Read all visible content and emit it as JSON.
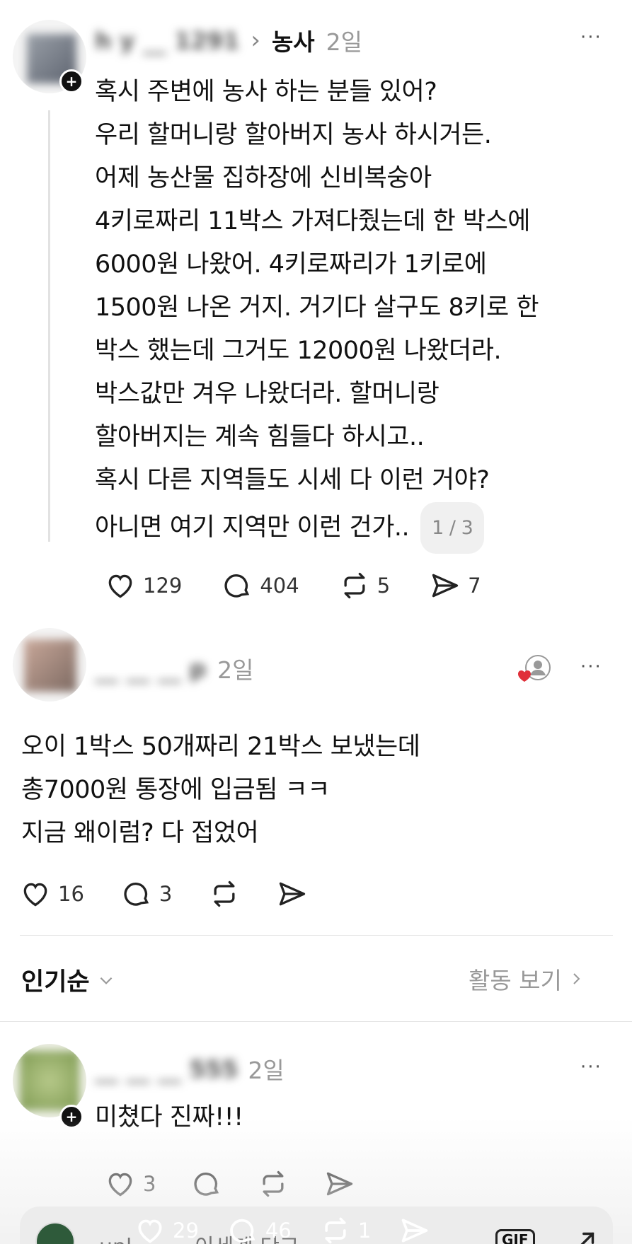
{
  "post": {
    "username": "h y __ 1291",
    "arrow": "›",
    "topic": "농사",
    "time": "2일",
    "more": "···",
    "lines": [
      "혹시 주변에 농사 하는 분들 있어?",
      "우리 할머니랑 할아버지 농사 하시거든.",
      "어제 농산물 집하장에 신비복숭아",
      "4키로짜리 11박스 가져다줬는데 한 박스에",
      "6000원 나왔어. 4키로짜리가 1키로에",
      "1500원 나온 거지. 거기다 살구도 8키로 한",
      "박스 했는데 그거도 12000원 나왔더라.",
      "박스값만 겨우 나왔더라. 할머니랑",
      "할아버지는 계속 힘들다 하시고..",
      "혹시 다른 지역들도 시세 다 이런 거야?",
      "아니면 여기 지역만 이런 건가.."
    ],
    "page_badge": "1 / 3",
    "likes": "129",
    "comments": "404",
    "reposts": "5",
    "shares": "7"
  },
  "reply": {
    "username": "__ __ __ p",
    "time": "2일",
    "more": "···",
    "lines": [
      "오이 1박스 50개짜리 21박스 보냈는데",
      "총7000원 통장에 입금됨 ㅋㅋ",
      "지금 왜이럼? 다 접었어"
    ],
    "likes": "16",
    "comments": "3"
  },
  "sort": {
    "label": "인기순",
    "activity": "활동 보기"
  },
  "comment": {
    "username": "__ __ __ 555",
    "time": "2일",
    "more": "···",
    "text": "미쳤다 진짜!!!",
    "likes": "3"
  },
  "bottom_bar": {
    "likes": "29",
    "comments": "46",
    "reposts": "1",
    "name_text": "upl __ __ 이세계 단고",
    "gif_label": "GIF"
  }
}
